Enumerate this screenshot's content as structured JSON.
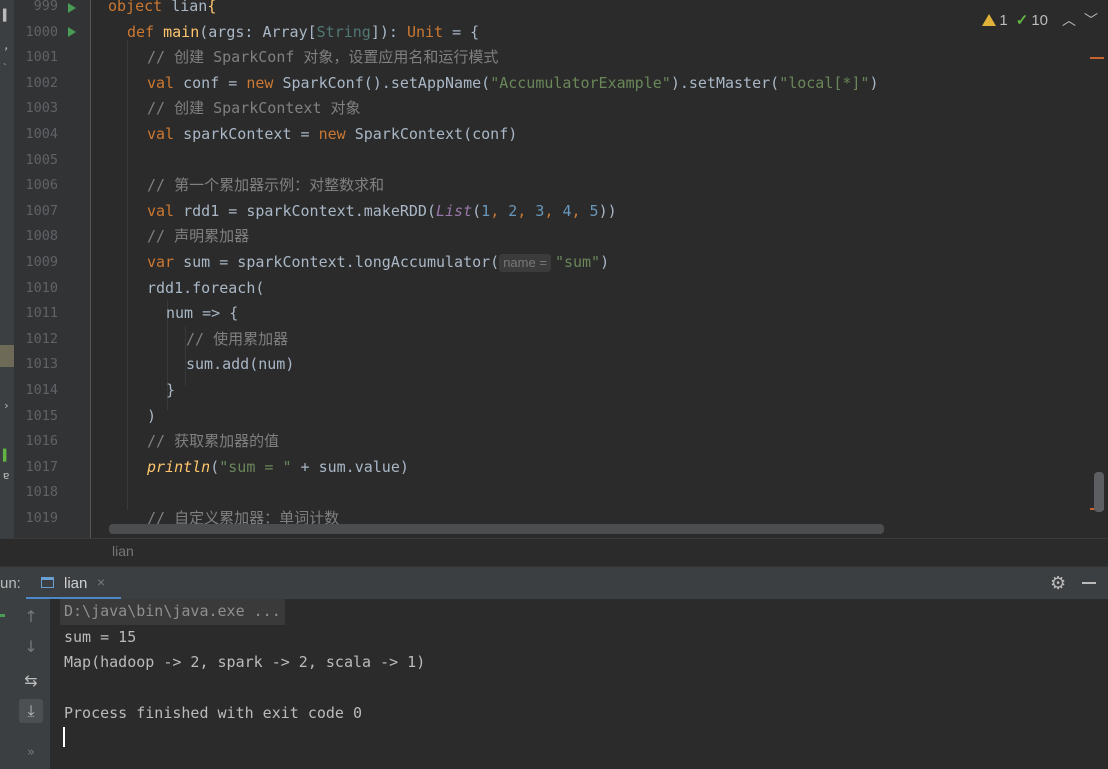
{
  "editor": {
    "line_numbers": [
      "999",
      "1000",
      "1001",
      "1002",
      "1003",
      "1004",
      "1005",
      "1006",
      "1007",
      "1008",
      "1009",
      "1010",
      "1011",
      "1012",
      "1013",
      "1014",
      "1015",
      "1016",
      "1017",
      "1018",
      "1019"
    ],
    "lines": {
      "l999": {
        "kw": "object",
        "name": "lian",
        "brace": "{"
      },
      "l1000": {
        "kw": "def",
        "fn": "main",
        "p1": "(args: Array[",
        "type": "String",
        "p2": "]): ",
        "ret": "Unit",
        "p3": " = {"
      },
      "l1001": {
        "comment": "// 创建 SparkConf 对象，设置应用名和运行模式"
      },
      "l1002": {
        "kw1": "val",
        "t1": " conf = ",
        "kw2": "new",
        "t2": " SparkConf().setAppName(",
        "s1": "\"AccumulatorExample\"",
        "t3": ").setMaster(",
        "s2": "\"local[*]\"",
        "t4": ")"
      },
      "l1003": {
        "comment": "// 创建 SparkContext 对象"
      },
      "l1004": {
        "kw1": "val",
        "t1": " sparkContext = ",
        "kw2": "new",
        "t2": " SparkContext(conf)"
      },
      "l1006": {
        "comment": "// 第一个累加器示例：对整数求和"
      },
      "l1007": {
        "kw1": "val",
        "t1": " rdd1 = sparkContext.makeRDD(",
        "list": "List",
        "t2": "(",
        "n1": "1",
        "c1": ", ",
        "n2": "2",
        "c2": ", ",
        "n3": "3",
        "c3": ", ",
        "n4": "4",
        "c4": ", ",
        "n5": "5",
        "t3": "))"
      },
      "l1008": {
        "comment": "// 声明累加器"
      },
      "l1009": {
        "kw1": "var",
        "t1": " sum = sparkContext.longAccumulator(",
        "hint": "name =",
        "s1": "\"sum\"",
        "t2": ")"
      },
      "l1010": {
        "text": "rdd1.foreach("
      },
      "l1011": {
        "text": "num => {"
      },
      "l1012": {
        "comment": "// 使用累加器"
      },
      "l1013": {
        "text": "sum.add(num)"
      },
      "l1014": {
        "text": "}"
      },
      "l1015": {
        "text": ")"
      },
      "l1016": {
        "comment": "// 获取累加器的值"
      },
      "l1017": {
        "fn": "println",
        "t1": "(",
        "s1": "\"sum = \"",
        "t2": " + sum.value)"
      },
      "l1019": {
        "comment": "// 自定义累加器：单词计数"
      }
    },
    "inspections": {
      "warnings": "1",
      "typos": "10"
    }
  },
  "breadcrumb": "lian",
  "run_panel": {
    "label": "un:",
    "tab_label": "lian",
    "tab_close": "×",
    "console": [
      "D:\\java\\bin\\java.exe ...",
      "sum = 15",
      "Map(hadoop -> 2, spark -> 2, scala -> 1)",
      "",
      "Process finished with exit code 0"
    ]
  },
  "colors": {
    "keyword": "#cc7832",
    "string": "#6a8759",
    "number": "#6897bb",
    "function": "#ffc66d",
    "comment": "#808080",
    "accent": "#4a88c7"
  }
}
